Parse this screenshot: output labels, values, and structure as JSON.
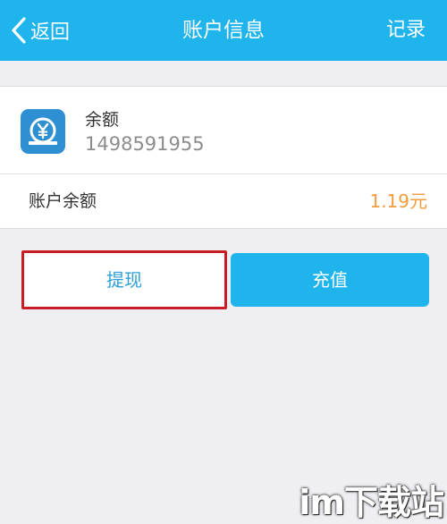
{
  "header": {
    "back_label": "返回",
    "title": "账户信息",
    "record_label": "记录"
  },
  "account": {
    "icon": "yen-coin-icon",
    "name": "余额",
    "number": "1498591955"
  },
  "balance": {
    "label": "账户余额",
    "value": "1.19元"
  },
  "actions": {
    "withdraw_label": "提现",
    "recharge_label": "充值"
  },
  "colors": {
    "header_bg": "#1fb5ec",
    "page_bg": "#eeeef3",
    "balance_value": "#f39c3c",
    "highlight_border": "#c81d25",
    "icon_bg": "#2f8fd3"
  },
  "watermark": "im下载站"
}
